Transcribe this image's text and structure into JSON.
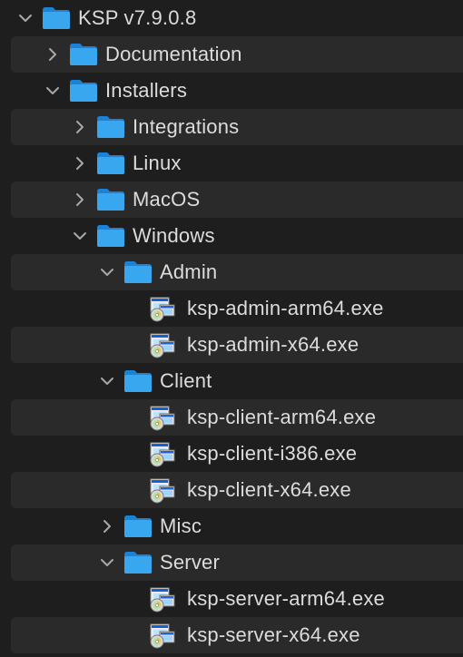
{
  "colors": {
    "background": "#1e1e1e",
    "row_alt": "#2a2a2a",
    "text": "#dcdcdc",
    "chevron": "#a8a8a8",
    "folder_front": "#39a7f0",
    "folder_back": "#1d82d2"
  },
  "tree": [
    {
      "label": "KSP v7.9.0.8",
      "depth": 0,
      "kind": "folder",
      "expanded": true,
      "icon": "folder-icon"
    },
    {
      "label": "Documentation",
      "depth": 1,
      "kind": "folder",
      "expanded": false,
      "icon": "folder-icon"
    },
    {
      "label": "Installers",
      "depth": 1,
      "kind": "folder",
      "expanded": true,
      "icon": "folder-icon"
    },
    {
      "label": "Integrations",
      "depth": 2,
      "kind": "folder",
      "expanded": false,
      "icon": "folder-icon"
    },
    {
      "label": "Linux",
      "depth": 2,
      "kind": "folder",
      "expanded": false,
      "icon": "folder-icon"
    },
    {
      "label": "MacOS",
      "depth": 2,
      "kind": "folder",
      "expanded": false,
      "icon": "folder-icon"
    },
    {
      "label": "Windows",
      "depth": 2,
      "kind": "folder",
      "expanded": true,
      "icon": "folder-icon"
    },
    {
      "label": "Admin",
      "depth": 3,
      "kind": "folder",
      "expanded": true,
      "icon": "folder-icon"
    },
    {
      "label": "ksp-admin-arm64.exe",
      "depth": 4,
      "kind": "file",
      "icon": "installer-exe-icon"
    },
    {
      "label": "ksp-admin-x64.exe",
      "depth": 4,
      "kind": "file",
      "icon": "installer-exe-icon"
    },
    {
      "label": "Client",
      "depth": 3,
      "kind": "folder",
      "expanded": true,
      "icon": "folder-icon"
    },
    {
      "label": "ksp-client-arm64.exe",
      "depth": 4,
      "kind": "file",
      "icon": "installer-exe-icon"
    },
    {
      "label": "ksp-client-i386.exe",
      "depth": 4,
      "kind": "file",
      "icon": "installer-exe-icon"
    },
    {
      "label": "ksp-client-x64.exe",
      "depth": 4,
      "kind": "file",
      "icon": "installer-exe-icon"
    },
    {
      "label": "Misc",
      "depth": 3,
      "kind": "folder",
      "expanded": false,
      "icon": "folder-icon"
    },
    {
      "label": "Server",
      "depth": 3,
      "kind": "folder",
      "expanded": true,
      "icon": "folder-icon"
    },
    {
      "label": "ksp-server-arm64.exe",
      "depth": 4,
      "kind": "file",
      "icon": "installer-exe-icon"
    },
    {
      "label": "ksp-server-x64.exe",
      "depth": 4,
      "kind": "file",
      "icon": "installer-exe-icon"
    }
  ]
}
